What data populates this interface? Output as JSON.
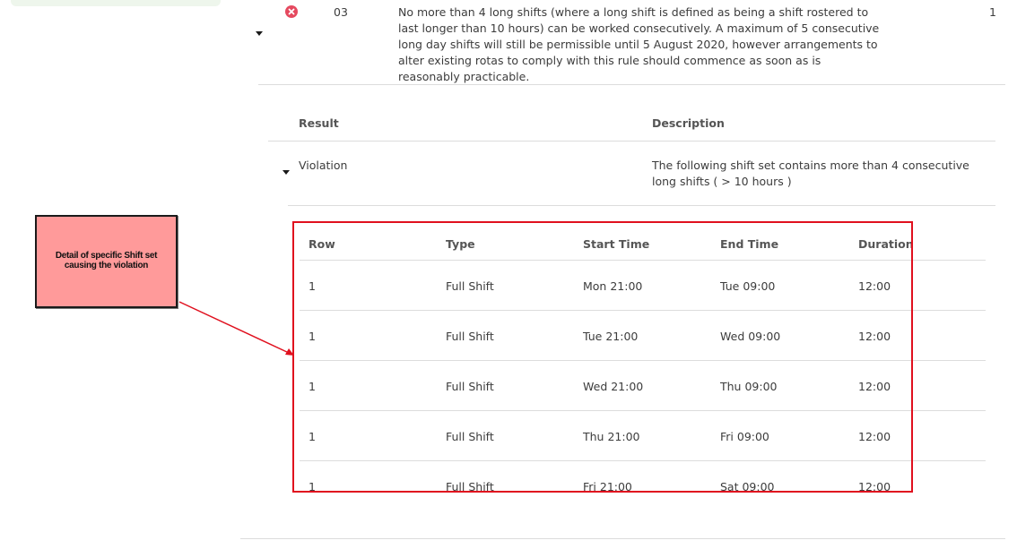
{
  "rule": {
    "status_icon": "error-x-icon",
    "status_color": "#e5495f",
    "code": "03",
    "description": "No more than 4 long shifts (where a long shift is defined as being a shift rostered to last longer than 10 hours) can be worked consecutively. A maximum of 5 consecutive long day shifts will still be permissible until 5 August 2020, however arrangements to alter existing rotas to comply with this rule should commence as soon as is reasonably practicable.",
    "count": "1"
  },
  "results": {
    "headers": {
      "result": "Result",
      "description": "Description"
    },
    "row": {
      "result": "Violation",
      "description": "The following shift set contains more than 4 consecutive long shifts ( > 10 hours )"
    }
  },
  "shifts": {
    "headers": {
      "row": "Row",
      "type": "Type",
      "start": "Start Time",
      "end": "End Time",
      "duration": "Duration"
    },
    "rows": [
      {
        "row": "1",
        "type": "Full Shift",
        "start": "Mon 21:00",
        "end": "Tue 09:00",
        "duration": "12:00"
      },
      {
        "row": "1",
        "type": "Full Shift",
        "start": "Tue 21:00",
        "end": "Wed 09:00",
        "duration": "12:00"
      },
      {
        "row": "1",
        "type": "Full Shift",
        "start": "Wed 21:00",
        "end": "Thu 09:00",
        "duration": "12:00"
      },
      {
        "row": "1",
        "type": "Full Shift",
        "start": "Thu 21:00",
        "end": "Fri 09:00",
        "duration": "12:00"
      },
      {
        "row": "1",
        "type": "Full Shift",
        "start": "Fri 21:00",
        "end": "Sat 09:00",
        "duration": "12:00"
      }
    ]
  },
  "annotation": {
    "text": "Detail of specific Shift set causing the violation",
    "box_color": "#ff9a9a",
    "highlight_color": "#e0101e"
  }
}
